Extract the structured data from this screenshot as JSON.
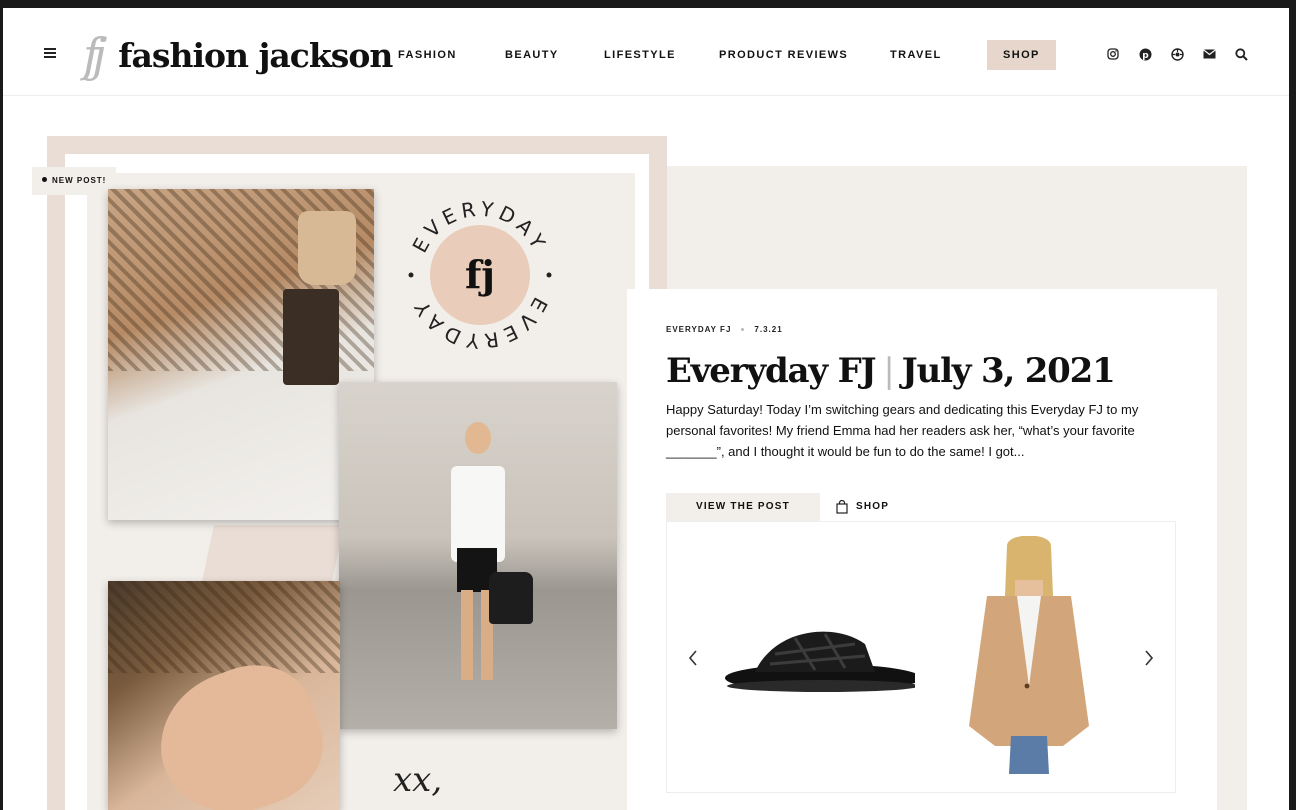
{
  "header": {
    "logo_mark": "fj",
    "logo_text": "fashion jackson",
    "nav": [
      {
        "label": "FASHION"
      },
      {
        "label": "BEAUTY"
      },
      {
        "label": "LIFESTYLE"
      },
      {
        "label": "PRODUCT REVIEWS"
      },
      {
        "label": "TRAVEL"
      },
      {
        "label": "SHOP"
      }
    ],
    "social_icons": [
      "instagram-icon",
      "pinterest-icon",
      "shopping-bag-icon",
      "mail-icon",
      "search-icon"
    ]
  },
  "hero": {
    "badge": "NEW POST!",
    "stamp_top": "EVERYDAY",
    "stamp_bottom": "EVERYDAY",
    "stamp_center": "fj",
    "signature": "xx,"
  },
  "post": {
    "category": "EVERYDAY FJ",
    "date": "7.3.21",
    "title_part1": "Everyday FJ",
    "title_separator": "|",
    "title_part2": "July 3, 2021",
    "excerpt": "Happy Saturday! Today I’m switching gears and dedicating this Everyday FJ to my personal favorites! My friend Emma had her readers ask her, “what’s your favorite _______”, and I thought it would be fun to do the same! I got...",
    "view_button": "VIEW THE POST",
    "shop_tab": "SHOP"
  },
  "colors": {
    "accent": "#e6d6cb",
    "panel": "#f2eeea",
    "text": "#111111"
  }
}
